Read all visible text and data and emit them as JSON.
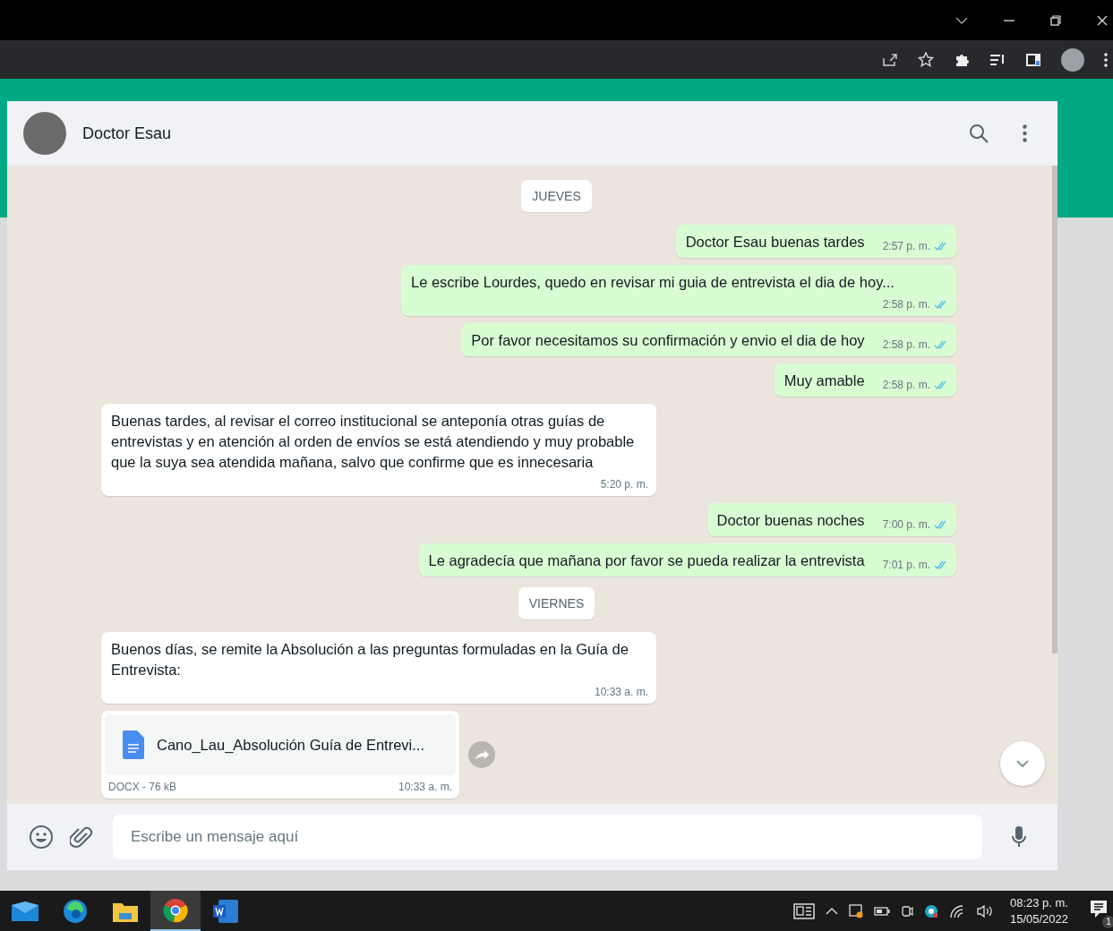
{
  "chat_header": {
    "contact_name": "Doctor Esau"
  },
  "messages": [
    {
      "kind": "date",
      "text": "JUEVES"
    },
    {
      "kind": "outgoing",
      "text": "Doctor Esau buenas tardes",
      "time": "2:57 p. m.",
      "read": true
    },
    {
      "kind": "outgoing",
      "text": "Le escribe Lourdes, quedo en revisar mi guia de entrevista el dia de hoy...",
      "time": "2:58 p. m.",
      "read": true
    },
    {
      "kind": "outgoing",
      "text": "Por favor necesitamos su confirmación y envio el dia de hoy",
      "time": "2:58 p. m.",
      "read": true
    },
    {
      "kind": "outgoing",
      "text": "Muy amable",
      "time": "2:58 p. m.",
      "read": true
    },
    {
      "kind": "incoming",
      "text": "Buenas tardes, al revisar el correo institucional se anteponía otras guías de entrevistas y en atención al orden de envíos se está atendiendo y muy probable que la suya sea atendida mañana, salvo que confirme que es innecesaria",
      "time": "5:20 p. m."
    },
    {
      "kind": "outgoing",
      "text": "Doctor buenas noches",
      "time": "7:00 p. m.",
      "read": true
    },
    {
      "kind": "outgoing",
      "text": "Le agradecía que mañana por favor se pueda realizar la entrevista",
      "time": "7:01 p. m.",
      "read": true
    },
    {
      "kind": "date",
      "text": "VIERNES"
    },
    {
      "kind": "incoming",
      "text": "Buenos días, se remite la Absolución a las preguntas formuladas en la Guía de Entrevista:",
      "time": "10:33 a. m."
    },
    {
      "kind": "document",
      "file_name": "Cano_Lau_Absolución Guía de Entrevi...",
      "meta": "DOCX - 76 kB",
      "time": "10:33 a. m."
    }
  ],
  "composer": {
    "placeholder": "Escribe un mensaje aquí"
  },
  "taskbar": {
    "apps": [
      {
        "kind": "mail",
        "selected": false
      },
      {
        "kind": "edge",
        "selected": false
      },
      {
        "kind": "folder",
        "selected": false
      },
      {
        "kind": "chrome",
        "selected": true
      },
      {
        "kind": "word",
        "selected": false
      }
    ],
    "clock_time": "08:23 p. m.",
    "clock_date": "15/05/2022",
    "notification_count": "1"
  }
}
